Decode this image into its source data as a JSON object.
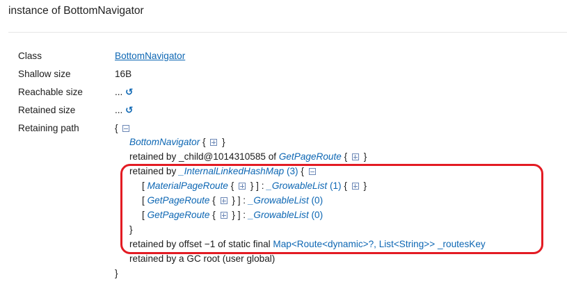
{
  "page_title": "instance of BottomNavigator",
  "props": [
    {
      "label": "Class",
      "value": "BottomNavigator"
    },
    {
      "label": "Shallow size",
      "value": "16B"
    },
    {
      "label": "Reachable size",
      "value": "..."
    },
    {
      "label": "Retained size",
      "value": "..."
    },
    {
      "label": "Retaining path",
      "value": "{"
    }
  ],
  "path": {
    "l1_class": "BottomNavigator",
    "l2_prefix": "retained by _child@1014310585 of ",
    "l2_class": "GetPageRoute",
    "l3_prefix": "retained by ",
    "l3_class": "_InternalLinkedHashMap",
    "l3_count": "(3)",
    "entries": [
      {
        "key": "MaterialPageRoute",
        "list": "_GrowableList",
        "count": "(1)"
      },
      {
        "key": "GetPageRoute",
        "list": "_GrowableList",
        "count": "(0)"
      },
      {
        "key": "GetPageRoute",
        "list": "_GrowableList",
        "count": "(0)"
      }
    ],
    "l8_prefix": "retained by offset −1 of static final ",
    "l8_link": "Map<Route<dynamic>?, List<String>> _routesKey",
    "l9": "retained by a GC root (user global)"
  },
  "icons": {
    "refresh": "refresh-icon",
    "expand": "expand-icon",
    "collapse": "collapse-icon"
  },
  "colors": {
    "link": "#0c66b3",
    "highlight": "#e31b23"
  }
}
